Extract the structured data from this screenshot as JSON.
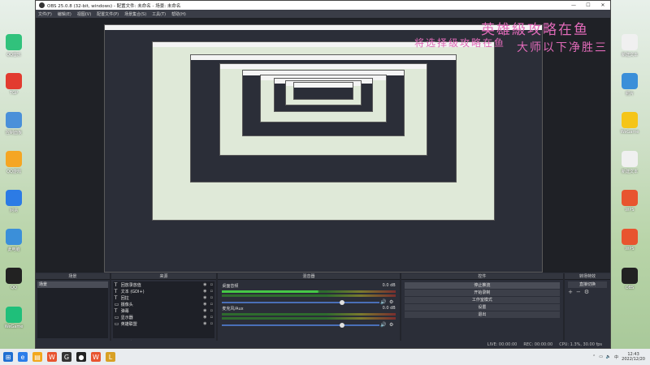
{
  "window": {
    "title": "OBS 25.0.8 (32-bit, windows) - 配置文件: 未命名 - 场景: 未命名",
    "controls": [
      "—",
      "☐",
      "✕"
    ]
  },
  "menu": [
    "文件(F)",
    "编辑(E)",
    "视图(V)",
    "配置文件(P)",
    "场景集合(S)",
    "工具(T)",
    "帮助(H)"
  ],
  "overlay": {
    "line1": "英雄級攻略在鱼",
    "line2": "将选择级攻略在鱼",
    "line3": "大师以下净胜三"
  },
  "docks": {
    "scenes": {
      "title": "场景",
      "items": [
        "场景"
      ]
    },
    "sources": {
      "title": "来源",
      "items": [
        {
          "type": "T",
          "label": "回放录放值"
        },
        {
          "type": "T",
          "label": "文本 (GDI+)"
        },
        {
          "type": "T",
          "label": "回拉"
        },
        {
          "type": "▭",
          "label": "摄像头"
        },
        {
          "type": "T",
          "label": "弹幕"
        },
        {
          "type": "▭",
          "label": "显示器"
        },
        {
          "type": "▭",
          "label": "英雄联盟"
        }
      ]
    },
    "mixer": {
      "title": "混音器",
      "channels": [
        {
          "name": "桌面音频",
          "db": "0.0 dB"
        },
        {
          "name": "麦克风/Aux",
          "db": "0.0 dB"
        }
      ]
    },
    "controls": {
      "title": "控件",
      "buttons": [
        "停止推流",
        "开始录制",
        "工作室模式",
        "设置",
        "退出"
      ]
    },
    "transitions": {
      "title": "转场特效",
      "selected": "直接切换"
    }
  },
  "statusbar": {
    "live": "LIVE: 00:00:00",
    "rec": "REC: 00:00:00",
    "cpu": "CPU: 1.3%, 30.00 fps"
  },
  "taskbar": {
    "time": "12:43",
    "date": "2022/12/20"
  },
  "desktop_icons": [
    {
      "label": "QQ音乐",
      "icon": "music-icon",
      "color": "#31c27c"
    },
    {
      "label": "TGP",
      "icon": "game-icon",
      "color": "#e23b2f"
    },
    {
      "label": "控制面板",
      "icon": "panel-icon",
      "color": "#4a90d9"
    },
    {
      "label": "QQ游戏",
      "icon": "qq-game-icon",
      "color": "#f5a623"
    },
    {
      "label": "网易",
      "icon": "browser-icon",
      "color": "#2c7be5"
    },
    {
      "label": "此电脑",
      "icon": "computer-icon",
      "color": "#3b8fd9"
    },
    {
      "label": "QQ",
      "icon": "qq-icon",
      "color": "#222222"
    },
    {
      "label": "WeGame",
      "icon": "wegame-icon",
      "color": "#1fbf7a"
    }
  ],
  "right_icons": [
    {
      "label": "新建文本",
      "icon": "doc-icon",
      "color": "#f0f0f0"
    },
    {
      "label": "照片",
      "icon": "photo-icon",
      "color": "#3b8fd9"
    },
    {
      "label": "WeGame",
      "icon": "wegame-icon",
      "color": "#f5c518"
    },
    {
      "label": "新建文本",
      "icon": "doc-icon",
      "color": "#f0f0f0"
    },
    {
      "label": "WPS",
      "icon": "wps-icon",
      "color": "#e8542f"
    },
    {
      "label": "WPS",
      "icon": "wps-icon",
      "color": "#e8542f"
    },
    {
      "label": "OBS",
      "icon": "obs-icon",
      "color": "#222222"
    }
  ]
}
